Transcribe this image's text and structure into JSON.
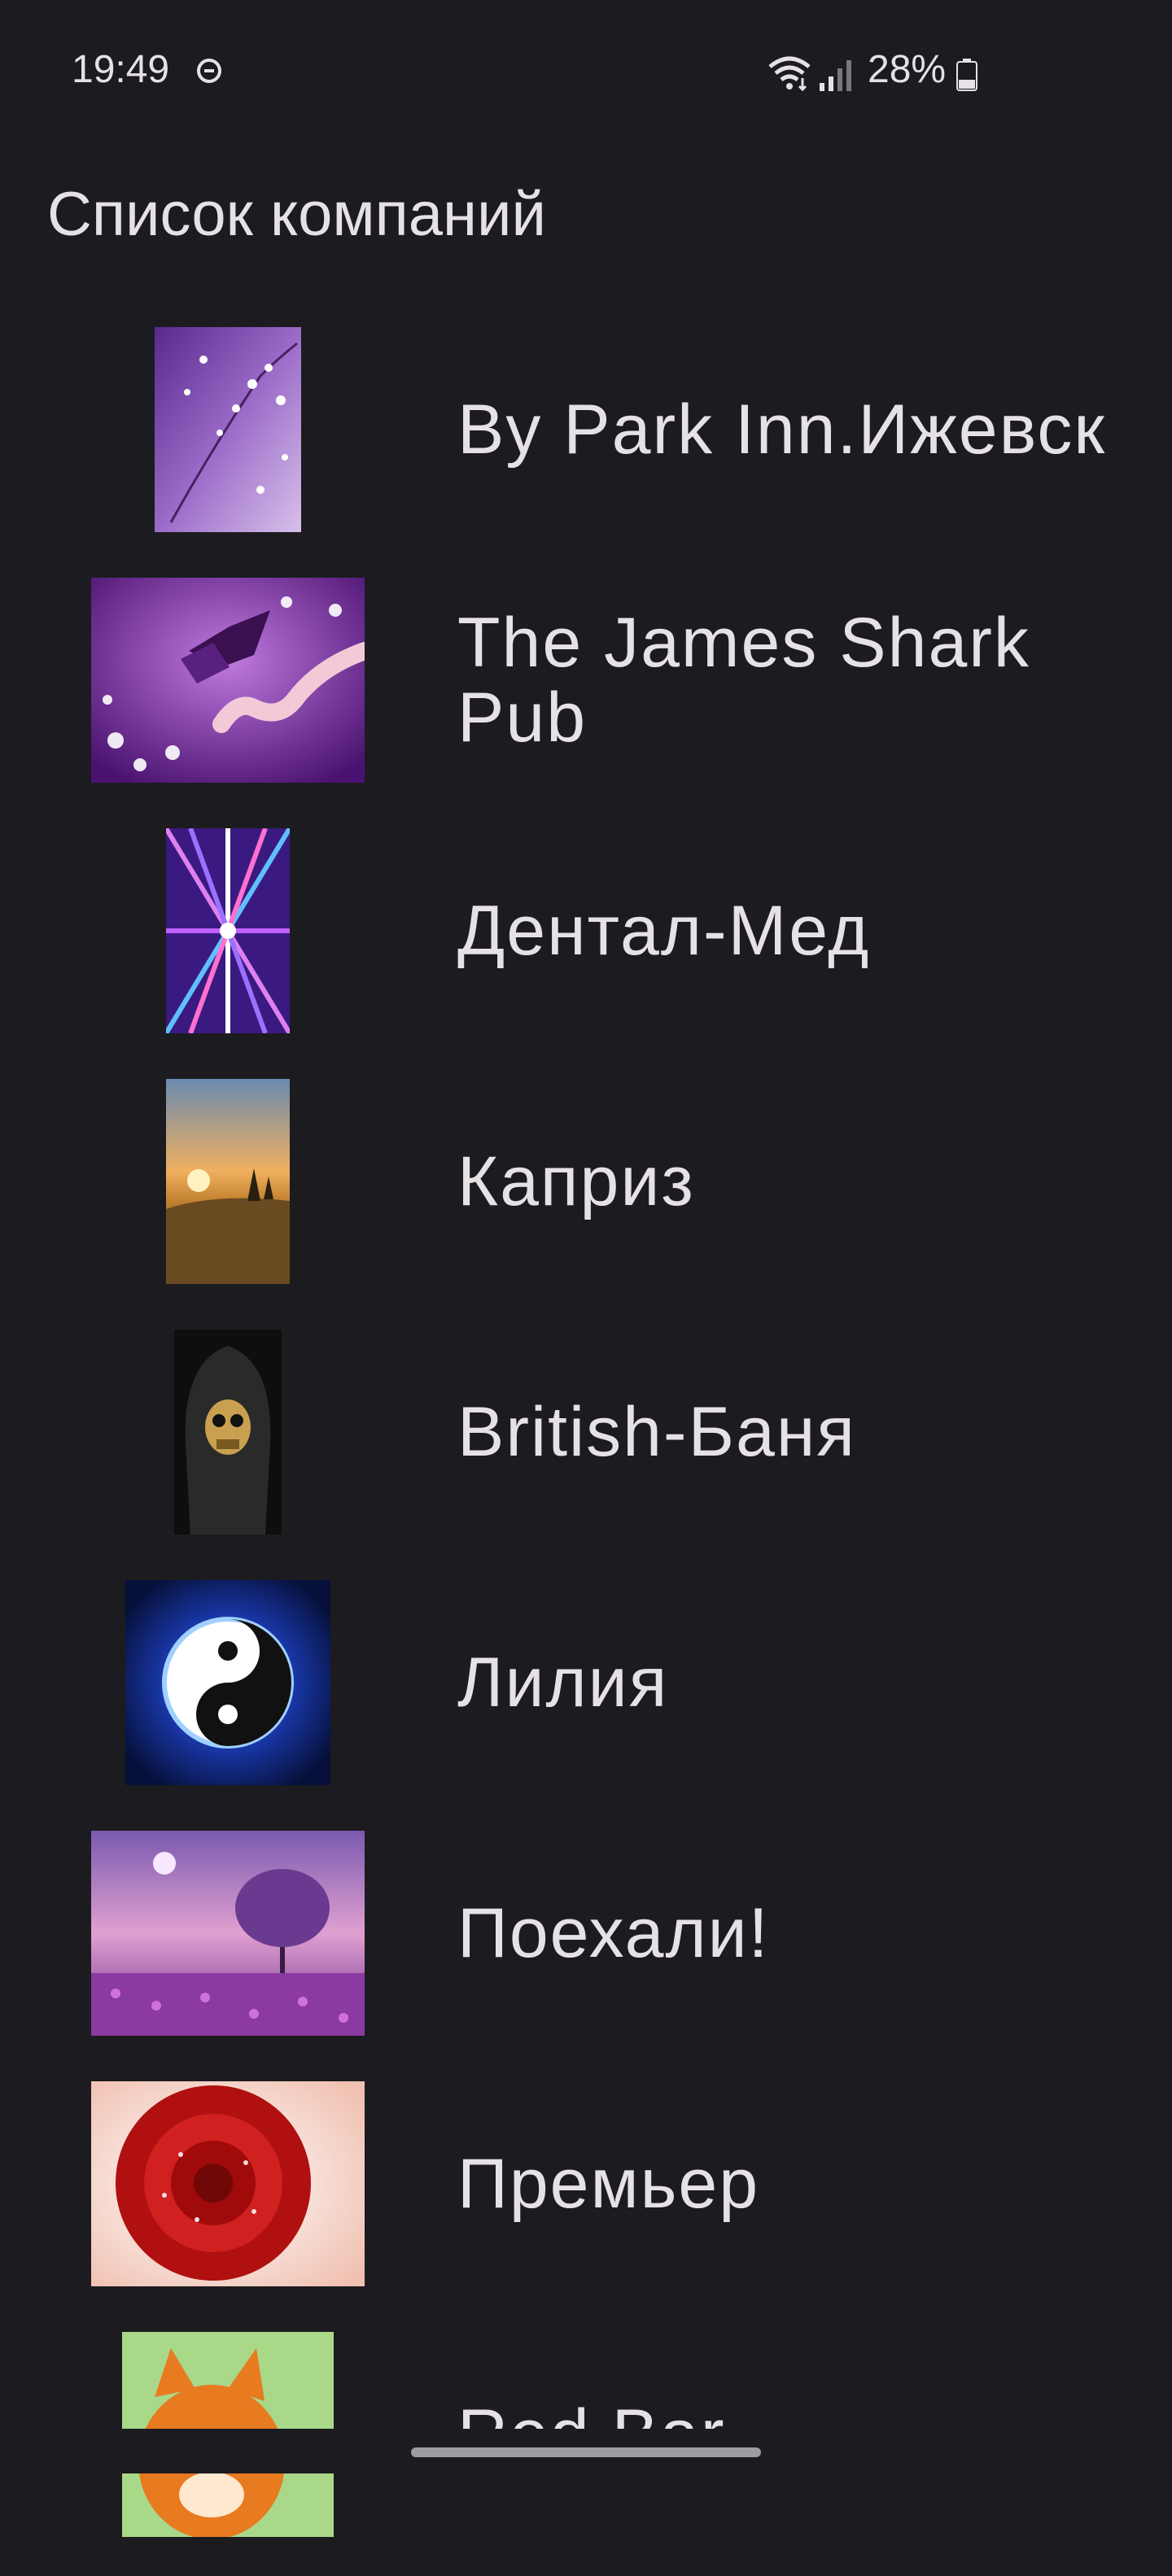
{
  "status_bar": {
    "time": "19:49",
    "battery_percent": "28%",
    "icons": [
      "do-not-disturb-icon",
      "wifi-icon",
      "cellular-signal-icon",
      "battery-icon"
    ]
  },
  "header": {
    "title": "Список компаний"
  },
  "companies": [
    {
      "name": "By Park Inn.Ижевск",
      "image": "purple-flower-branch"
    },
    {
      "name": "The James Shark Pub",
      "image": "butterfly-on-hand"
    },
    {
      "name": "Дентал-Мед",
      "image": "purple-light-burst"
    },
    {
      "name": "Каприз",
      "image": "sunset-landscape"
    },
    {
      "name": "British-Баня",
      "image": "hooded-skull"
    },
    {
      "name": "Лилия",
      "image": "yin-yang"
    },
    {
      "name": "Поехали!",
      "image": "purple-tree-field"
    },
    {
      "name": "Премьер",
      "image": "red-rose"
    },
    {
      "name": "Red Bar",
      "image": "cartoon-fox"
    }
  ],
  "colors": {
    "background": "#1c1b1f",
    "text": "#e6e1e5"
  }
}
